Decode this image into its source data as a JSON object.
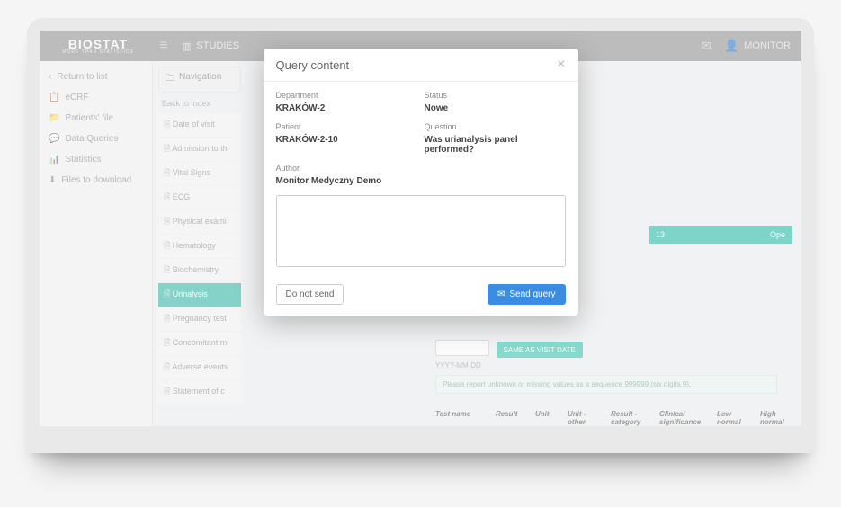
{
  "top": {
    "logo": "BIOSTAT",
    "logo_sub": "MORE THAN STATISTICS",
    "studies": "STUDIES",
    "monitor": "MONITOR"
  },
  "leftnav": {
    "return": "Return to list",
    "ecrf": "eCRF",
    "patients": "Patients' file",
    "queries": "Data Queries",
    "stats": "Statistics",
    "files": "Files to download"
  },
  "second": {
    "navigation": "Navigation",
    "back": "Back to index",
    "items": [
      "Date of visit",
      "Admission to th",
      "Vital Signs",
      "ECG",
      "Physical exami",
      "Hematology",
      "Biochemistry",
      "Urinalysis",
      "Pregnancy test",
      "Concomitant m",
      "Adverse events",
      "Statement of c"
    ],
    "selected_index": 7
  },
  "main": {
    "green_left": "13",
    "green_right": "Ope",
    "same_btn": "SAME AS VISIT DATE",
    "date_hint": "YYYY-MM-DD",
    "note": "Please report unknown or missing values as a sequence 999999 (six digits 9).",
    "thead": [
      "Test name",
      "Result",
      "Unit",
      "Unit - other",
      "Result - category",
      "Clinical significance",
      "Low normal",
      "High normal"
    ]
  },
  "modal": {
    "title": "Query content",
    "department_lbl": "Department",
    "department": "KRAKÓW-2",
    "status_lbl": "Status",
    "status": "Nowe",
    "patient_lbl": "Patient",
    "patient": "KRAKÓW-2-10",
    "question_lbl": "Question",
    "question": "Was urianalysis panel performed?",
    "author_lbl": "Author",
    "author": "Monitor Medyczny Demo",
    "do_not_send": "Do not send",
    "send": "Send query"
  }
}
